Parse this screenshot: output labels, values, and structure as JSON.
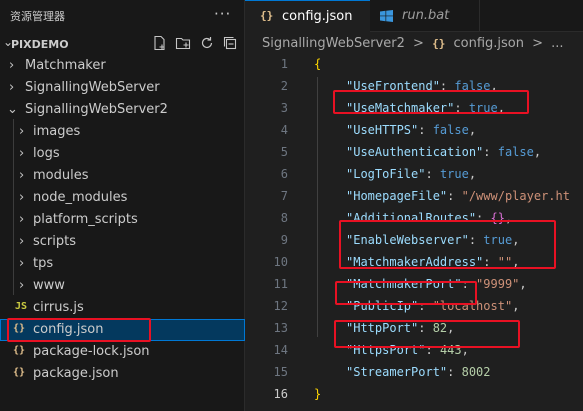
{
  "explorer": {
    "title": "资源管理器",
    "more_icon": "ellipsis-icon",
    "project_name": "PIXDEMO",
    "toolbar_icons": [
      "new-file-icon",
      "new-folder-icon",
      "refresh-icon",
      "collapse-all-icon"
    ],
    "items": [
      {
        "label": "Matchmaker",
        "type": "folder",
        "expanded": false
      },
      {
        "label": "SignallingWebServer",
        "type": "folder",
        "expanded": false
      },
      {
        "label": "SignallingWebServer2",
        "type": "folder",
        "expanded": true
      },
      {
        "label": "images",
        "type": "folder",
        "expanded": false
      },
      {
        "label": "logs",
        "type": "folder",
        "expanded": false
      },
      {
        "label": "modules",
        "type": "folder",
        "expanded": false
      },
      {
        "label": "node_modules",
        "type": "folder",
        "expanded": false
      },
      {
        "label": "platform_scripts",
        "type": "folder",
        "expanded": false
      },
      {
        "label": "scripts",
        "type": "folder",
        "expanded": false
      },
      {
        "label": "tps",
        "type": "folder",
        "expanded": false
      },
      {
        "label": "www",
        "type": "folder",
        "expanded": false
      },
      {
        "label": "cirrus.js",
        "type": "js",
        "icon_text": "JS"
      },
      {
        "label": "config.json",
        "type": "json",
        "icon_text": "{}",
        "selected": true
      },
      {
        "label": "package-lock.json",
        "type": "json",
        "icon_text": "{}"
      },
      {
        "label": "package.json",
        "type": "json",
        "icon_text": "{}"
      }
    ]
  },
  "tabs": [
    {
      "label": "config.json",
      "icon_text": "{}",
      "active": true
    },
    {
      "label": "run.bat",
      "icon": "windows-icon",
      "active": false
    }
  ],
  "breadcrumb": {
    "folder": "SignallingWebServer2",
    "separator": ">",
    "icon_text": "{}",
    "file": "config.json",
    "more": "..."
  },
  "code_lines": [
    {
      "num": "1",
      "text": "{"
    },
    {
      "num": "2",
      "key": "\"UseFrontend\"",
      "value": "false",
      "vtype": "b",
      "comma": ","
    },
    {
      "num": "3",
      "key": "\"UseMatchmaker\"",
      "value": "true",
      "vtype": "b",
      "comma": ","
    },
    {
      "num": "4",
      "key": "\"UseHTTPS\"",
      "value": "false",
      "vtype": "b",
      "comma": ","
    },
    {
      "num": "5",
      "key": "\"UseAuthentication\"",
      "value": "false",
      "vtype": "b",
      "comma": ","
    },
    {
      "num": "6",
      "key": "\"LogToFile\"",
      "value": "true",
      "vtype": "b",
      "comma": ","
    },
    {
      "num": "7",
      "key": "\"HomepageFile\"",
      "value": "\"/www/player.ht",
      "vtype": "s",
      "comma": ""
    },
    {
      "num": "8",
      "key": "\"AdditionalRoutes\"",
      "value": "{}",
      "vtype": "brace2",
      "comma": ","
    },
    {
      "num": "9",
      "key": "\"EnableWebserver\"",
      "value": "true",
      "vtype": "b",
      "comma": ","
    },
    {
      "num": "10",
      "key": "\"MatchmakerAddress\"",
      "value": "\"\"",
      "vtype": "s",
      "comma": ","
    },
    {
      "num": "11",
      "key": "\"MatchmakerPort\"",
      "value": "\"9999\"",
      "vtype": "s",
      "comma": ","
    },
    {
      "num": "12",
      "key": "\"PublicIp\"",
      "value": "\"localhost\"",
      "vtype": "s",
      "comma": ","
    },
    {
      "num": "13",
      "key": "\"HttpPort\"",
      "value": "82",
      "vtype": "n",
      "comma": ","
    },
    {
      "num": "14",
      "key": "\"HttpsPort\"",
      "value": "443",
      "vtype": "n",
      "comma": ","
    },
    {
      "num": "15",
      "key": "\"StreamerPort\"",
      "value": "8002",
      "vtype": "n",
      "comma": ""
    },
    {
      "num": "16",
      "text": "}"
    }
  ],
  "highlight_color": "#e81123"
}
